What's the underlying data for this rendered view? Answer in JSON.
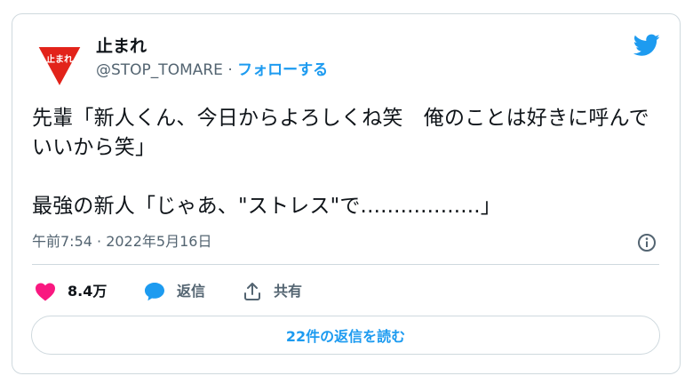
{
  "user": {
    "name": "止まれ",
    "handle": "@STOP_TOMARE",
    "separator": " · ",
    "follow_label": "フォローする",
    "avatar_text": "止まれ",
    "avatar_color": "#e2231a"
  },
  "tweet": {
    "text": "先輩「新人くん、今日からよろしくね笑　俺のことは好きに呼んでいいから笑」\n\n最強の新人「じゃあ、\"ストレス\"で..................」",
    "timestamp": "午前7:54 · 2022年5月16日"
  },
  "actions": {
    "likes": {
      "icon": "heart-icon",
      "label": "8.4万",
      "color": "#f91880"
    },
    "reply": {
      "icon": "reply-bubble-icon",
      "label": "返信",
      "color": "#1d9bf0"
    },
    "share": {
      "icon": "share-icon",
      "label": "共有"
    }
  },
  "replies_button": {
    "label": "22件の返信を読む"
  },
  "colors": {
    "accent": "#1d9bf0",
    "muted": "#536471",
    "border": "#cfd9de"
  }
}
